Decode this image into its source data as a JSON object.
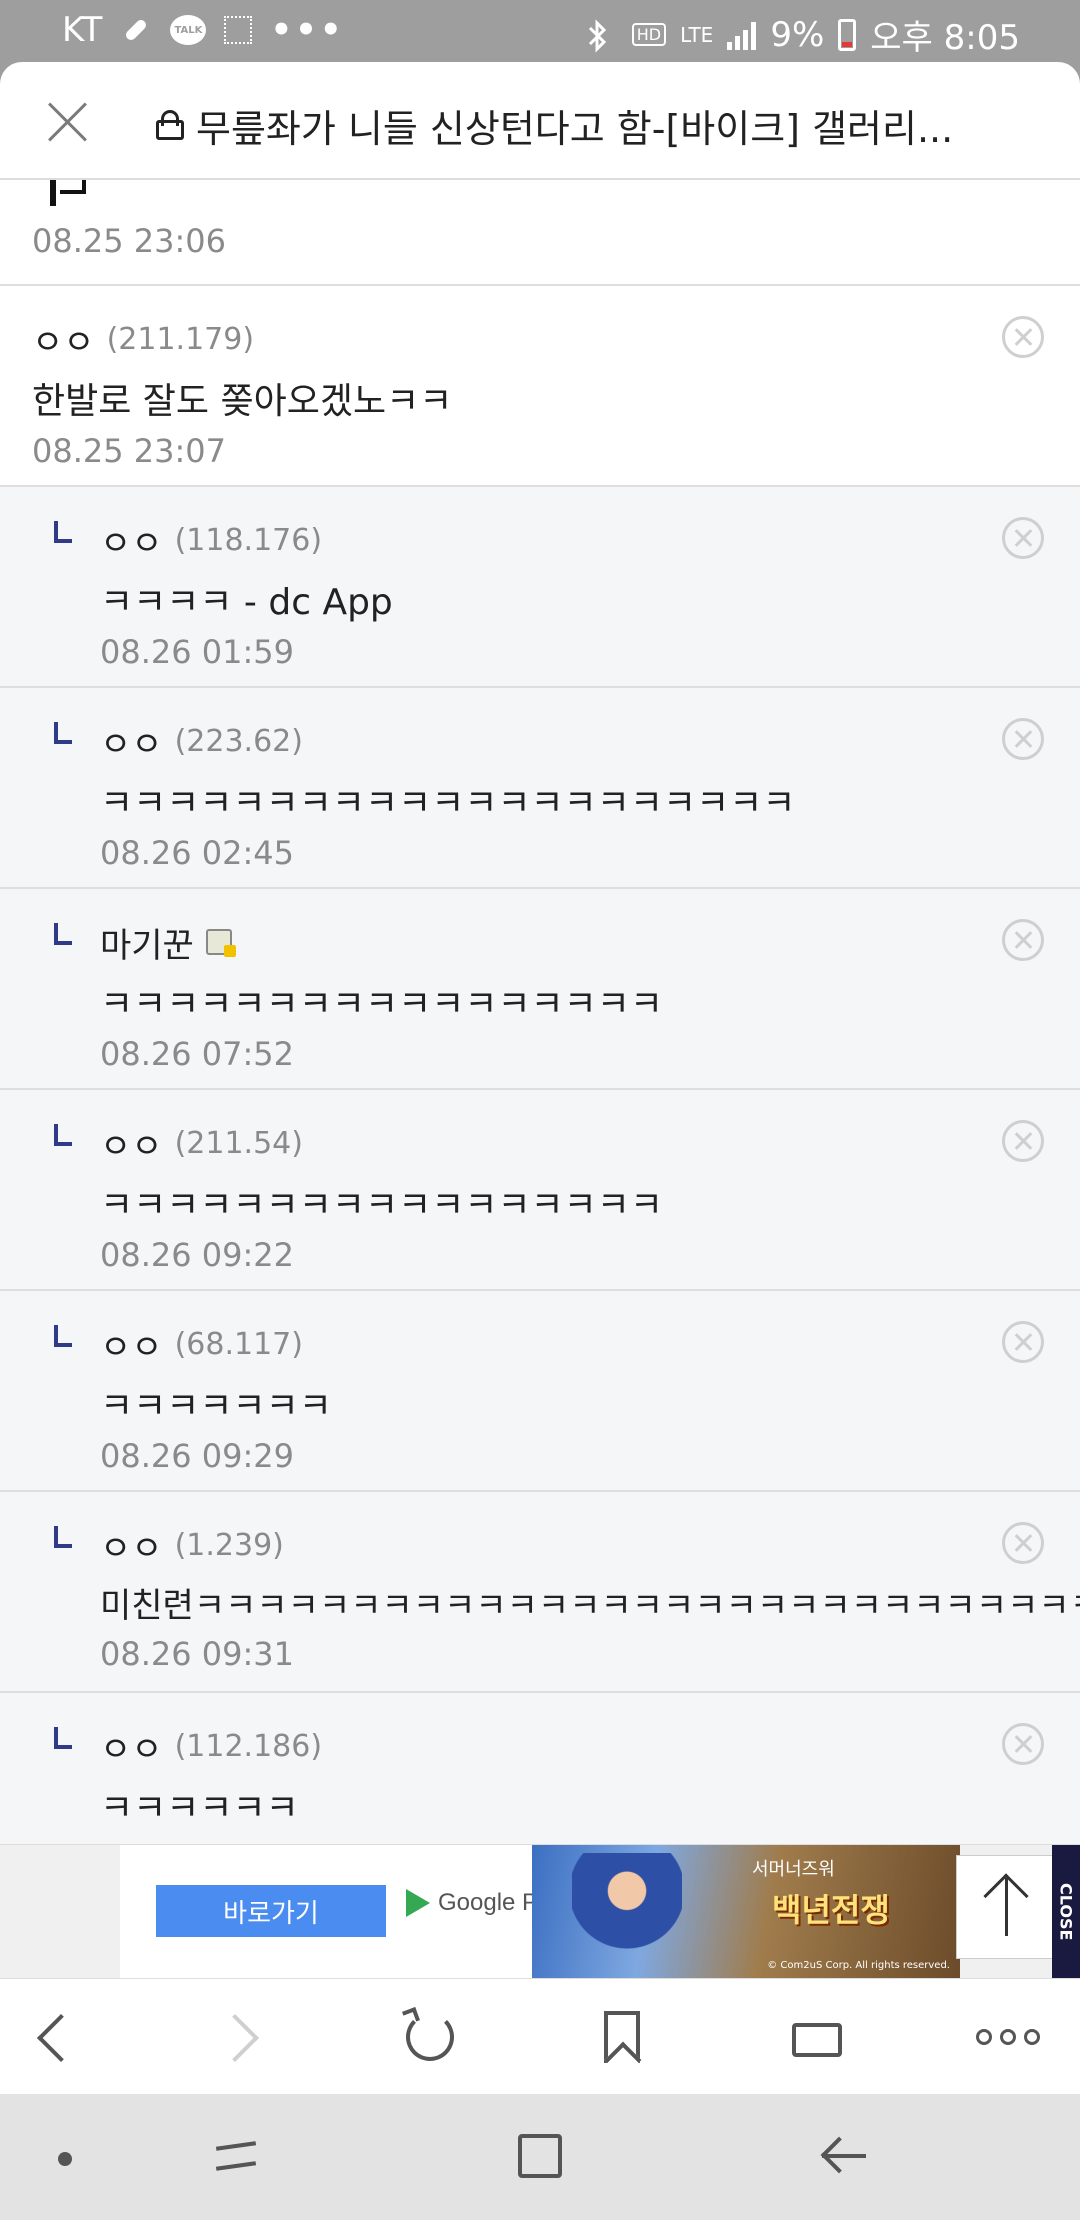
{
  "status_bar": {
    "carrier": "KT",
    "network": "LTE",
    "battery": "9%",
    "time": "오후 8:05",
    "icons": [
      "bandage-icon",
      "kakaotalk-icon",
      "screenshot-icon",
      "more-icon",
      "bluetooth-icon",
      "hd-icon",
      "lte-icon",
      "signal-icon",
      "battery-icon"
    ]
  },
  "header": {
    "title": "무릎좌가 니들 신상턴다고 함-[바이크] 갤러리...",
    "icons": [
      "close-icon",
      "lock-icon"
    ]
  },
  "partial_comment": {
    "date": "08.25 23:06"
  },
  "comments": [
    {
      "author": "ㅇㅇ",
      "ip": "(211.179)",
      "text": "한발로 잘도 쫒아오겠노ㅋㅋ",
      "date": "08.25 23:07",
      "reply": false
    },
    {
      "author": "ㅇㅇ",
      "ip": "(118.176)",
      "text": "ㅋㅋㅋㅋ - dc App",
      "date": "08.26 01:59",
      "reply": true
    },
    {
      "author": "ㅇㅇ",
      "ip": "(223.62)",
      "text": "ㅋㅋㅋㅋㅋㅋㅋㅋㅋㅋㅋㅋㅋㅋㅋㅋㅋㅋㅋㅋㅋ",
      "date": "08.26 02:45",
      "reply": true
    },
    {
      "author": "마기꾼",
      "ip": "",
      "text": "ㅋㅋㅋㅋㅋㅋㅋㅋㅋㅋㅋㅋㅋㅋㅋㅋㅋ",
      "date": "08.26 07:52",
      "reply": true,
      "badge": true
    },
    {
      "author": "ㅇㅇ",
      "ip": "(211.54)",
      "text": "ㅋㅋㅋㅋㅋㅋㅋㅋㅋㅋㅋㅋㅋㅋㅋㅋㅋ",
      "date": "08.26 09:22",
      "reply": true
    },
    {
      "author": "ㅇㅇ",
      "ip": "(68.117)",
      "text": "ㅋㅋㅋㅋㅋㅋㅋ",
      "date": "08.26 09:29",
      "reply": true
    },
    {
      "author": "ㅇㅇ",
      "ip": "(1.239)",
      "text": "미친련ㅋㅋㅋㅋㅋㅋㅋㅋㅋㅋㅋㅋㅋㅋㅋㅋㅋㅋㅋㅋㅋㅋㅋㅋㅋㅋㅋㅋㅋㅋㅋ",
      "date": "08.26 09:31",
      "reply": true
    },
    {
      "author": "ㅇㅇ",
      "ip": "(112.186)",
      "text": "ㅋㅋㅋㅋㅋㅋ",
      "date": "",
      "reply": true
    }
  ],
  "ad": {
    "button_label": "바로가기",
    "store_label": "Google Play",
    "game_title": "백년전쟁",
    "game_subtitle": "서머너즈워",
    "copyright": "© Com2uS Corp. All rights reserved.",
    "close_label": "CLOSE"
  },
  "toolbar": {
    "icons": [
      "back-icon",
      "forward-icon",
      "reload-icon",
      "bookmark-icon",
      "tabs-icon",
      "more-icon"
    ]
  },
  "colors": {
    "reply_bg": "#f5f6f8",
    "reply_marker": "#2f3b86",
    "ad_button": "#4a8cf0",
    "status_bar_bg": "#9e9e9e"
  }
}
